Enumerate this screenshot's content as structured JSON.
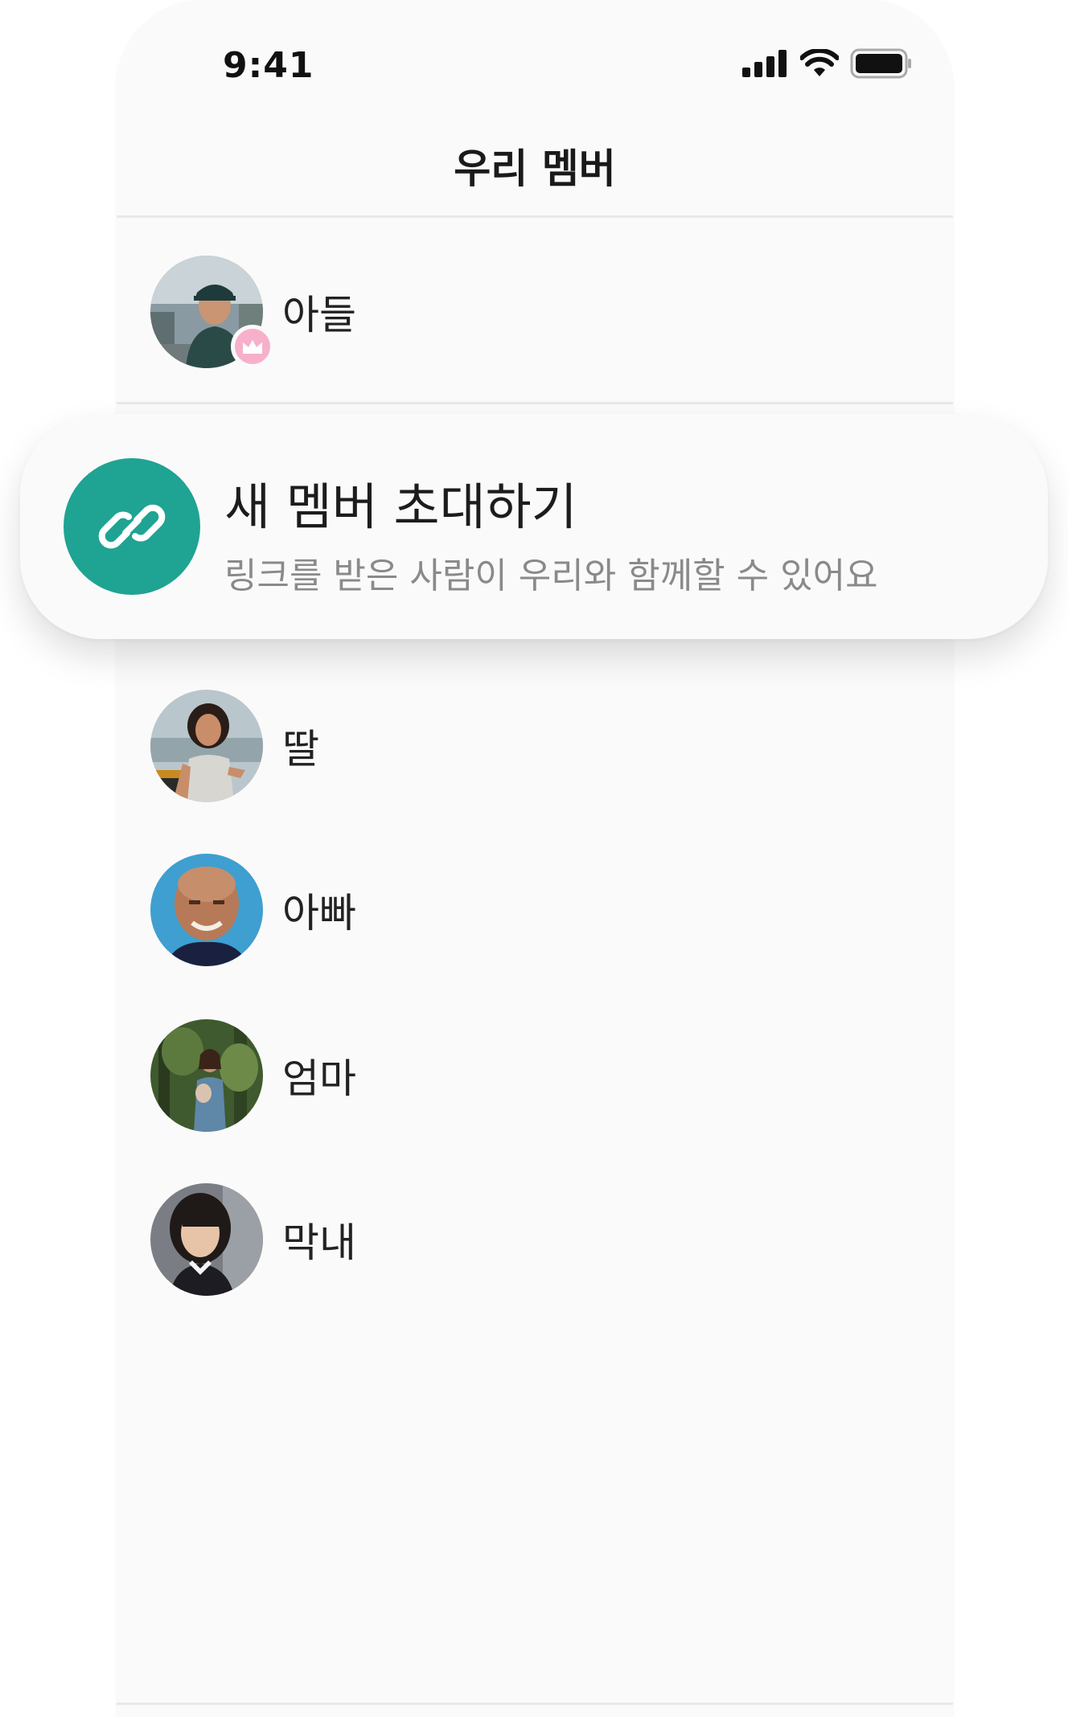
{
  "status_bar": {
    "time": "9:41",
    "icons": [
      "cellular-signal-icon",
      "wifi-icon",
      "battery-icon"
    ]
  },
  "header": {
    "title": "우리 멤버"
  },
  "members": [
    {
      "name": "아들",
      "avatar": "son-avatar",
      "badge": "crown-icon"
    },
    {
      "name": "딸",
      "avatar": "daughter-avatar"
    },
    {
      "name": "아빠",
      "avatar": "dad-avatar"
    },
    {
      "name": "엄마",
      "avatar": "mom-avatar"
    },
    {
      "name": "막내",
      "avatar": "youngest-avatar"
    }
  ],
  "invite": {
    "icon": "link-icon",
    "title": "새 멤버 초대하기",
    "subtitle": "링크를 받은 사람이 우리와 함께할 수 있어요"
  },
  "colors": {
    "accent": "#1fa393",
    "badge": "#f7b0cb",
    "background": "#fafafa",
    "subtitle_text": "#8a8a8a"
  }
}
